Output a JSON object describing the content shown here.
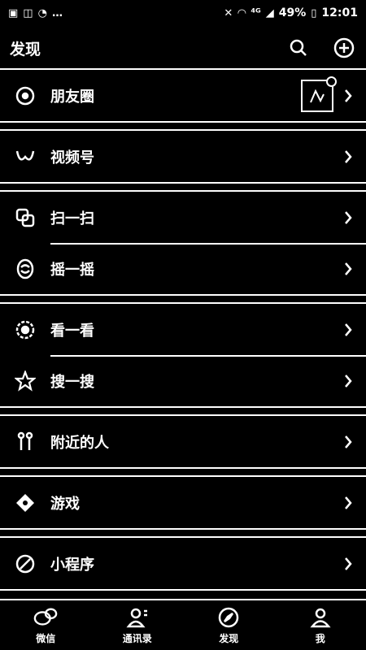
{
  "status_bar": {
    "left_icons": [
      "image-icon",
      "gallery-icon",
      "message-icon",
      "more-icon"
    ],
    "right_icons": [
      "mute-icon",
      "wifi-icon",
      "4g-icon",
      "signal-icon"
    ],
    "battery": "49%",
    "time": "12:01"
  },
  "header": {
    "title": "发现",
    "search_icon": "search-icon",
    "add_icon": "plus-circle-icon"
  },
  "menu": {
    "groups": [
      {
        "items": [
          {
            "label": "朋友圈",
            "icon": "moments-icon"
          }
        ]
      },
      {
        "items": [
          {
            "label": "视频号",
            "icon": "channels-icon"
          }
        ]
      },
      {
        "items": [
          {
            "label": "扫一扫",
            "icon": "scan-icon"
          },
          {
            "label": "摇一摇",
            "icon": "shake-icon"
          }
        ]
      },
      {
        "items": [
          {
            "label": "看一看",
            "icon": "top-stories-icon"
          },
          {
            "label": "搜一搜",
            "icon": "search-star-icon"
          }
        ]
      },
      {
        "items": [
          {
            "label": "附近的人",
            "icon": "nearby-people-icon"
          }
        ]
      },
      {
        "items": [
          {
            "label": "游戏",
            "icon": "games-icon"
          }
        ]
      },
      {
        "items": [
          {
            "label": "小程序",
            "icon": "mini-programs-icon"
          }
        ]
      }
    ]
  },
  "tabs": [
    {
      "label": "微信",
      "icon": "chats-icon"
    },
    {
      "label": "通讯录",
      "icon": "contacts-icon"
    },
    {
      "label": "发现",
      "icon": "discover-icon"
    },
    {
      "label": "我",
      "icon": "me-icon"
    }
  ],
  "colors": {
    "background": "#000000",
    "foreground": "#ffffff"
  }
}
